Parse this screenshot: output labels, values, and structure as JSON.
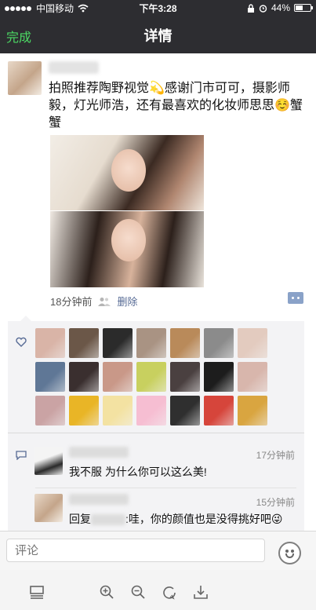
{
  "status_bar": {
    "carrier": "中国移动",
    "time": "下午3:28",
    "battery": "44%",
    "battery_level": 0.44
  },
  "nav": {
    "done_label": "完成",
    "title": "详情"
  },
  "post": {
    "text": "拍照推荐陶野视觉💫感谢门市可可，摄影师毅，灯光师浩，还有最喜欢的化妆师思思☺️蟹蟹",
    "time": "18分钟前",
    "delete_label": "删除"
  },
  "likes": {
    "avatars": [
      "like-avatar-1",
      "like-avatar-2",
      "like-avatar-3",
      "like-avatar-4",
      "like-avatar-5",
      "like-avatar-6",
      "like-avatar-7",
      "like-avatar-8",
      "like-avatar-9",
      "like-avatar-10",
      "like-avatar-11",
      "like-avatar-12",
      "like-avatar-13",
      "like-avatar-14",
      "like-avatar-15",
      "like-avatar-16",
      "like-avatar-17",
      "like-avatar-18",
      "like-avatar-19",
      "like-avatar-20",
      "like-avatar-21"
    ],
    "colors": [
      "#d9b4a7",
      "#6b5748",
      "#2b2b2b",
      "#a99383",
      "#b98a5a",
      "#8b8b8b",
      "#e3cbbf",
      "#5f7796",
      "#3a2f2f",
      "#c99888",
      "#c8d05f",
      "#4a4040",
      "#1d1d1d",
      "#d8b6ac",
      "#caa3a4",
      "#e9b526",
      "#f3e2a2",
      "#f6bed2",
      "#2f2f2f",
      "#d6453b",
      "#d9a540"
    ]
  },
  "comments": [
    {
      "time": "17分钟前",
      "text": "我不服 为什么你可以这么美!"
    },
    {
      "time": "15分钟前",
      "reply_prefix": "回复",
      "text": ":哇，你的颜值也是没得挑好吧😜"
    }
  ],
  "input": {
    "placeholder": "评论"
  },
  "toolbar": {
    "icons": [
      "layout-icon",
      "zoom-in-icon",
      "zoom-out-icon",
      "rotate-icon",
      "download-icon"
    ]
  },
  "colors": {
    "bar": "#2d2d31",
    "accent_green": "#4cd964",
    "link_blue": "#576b95",
    "panel": "#f3f3f5"
  }
}
